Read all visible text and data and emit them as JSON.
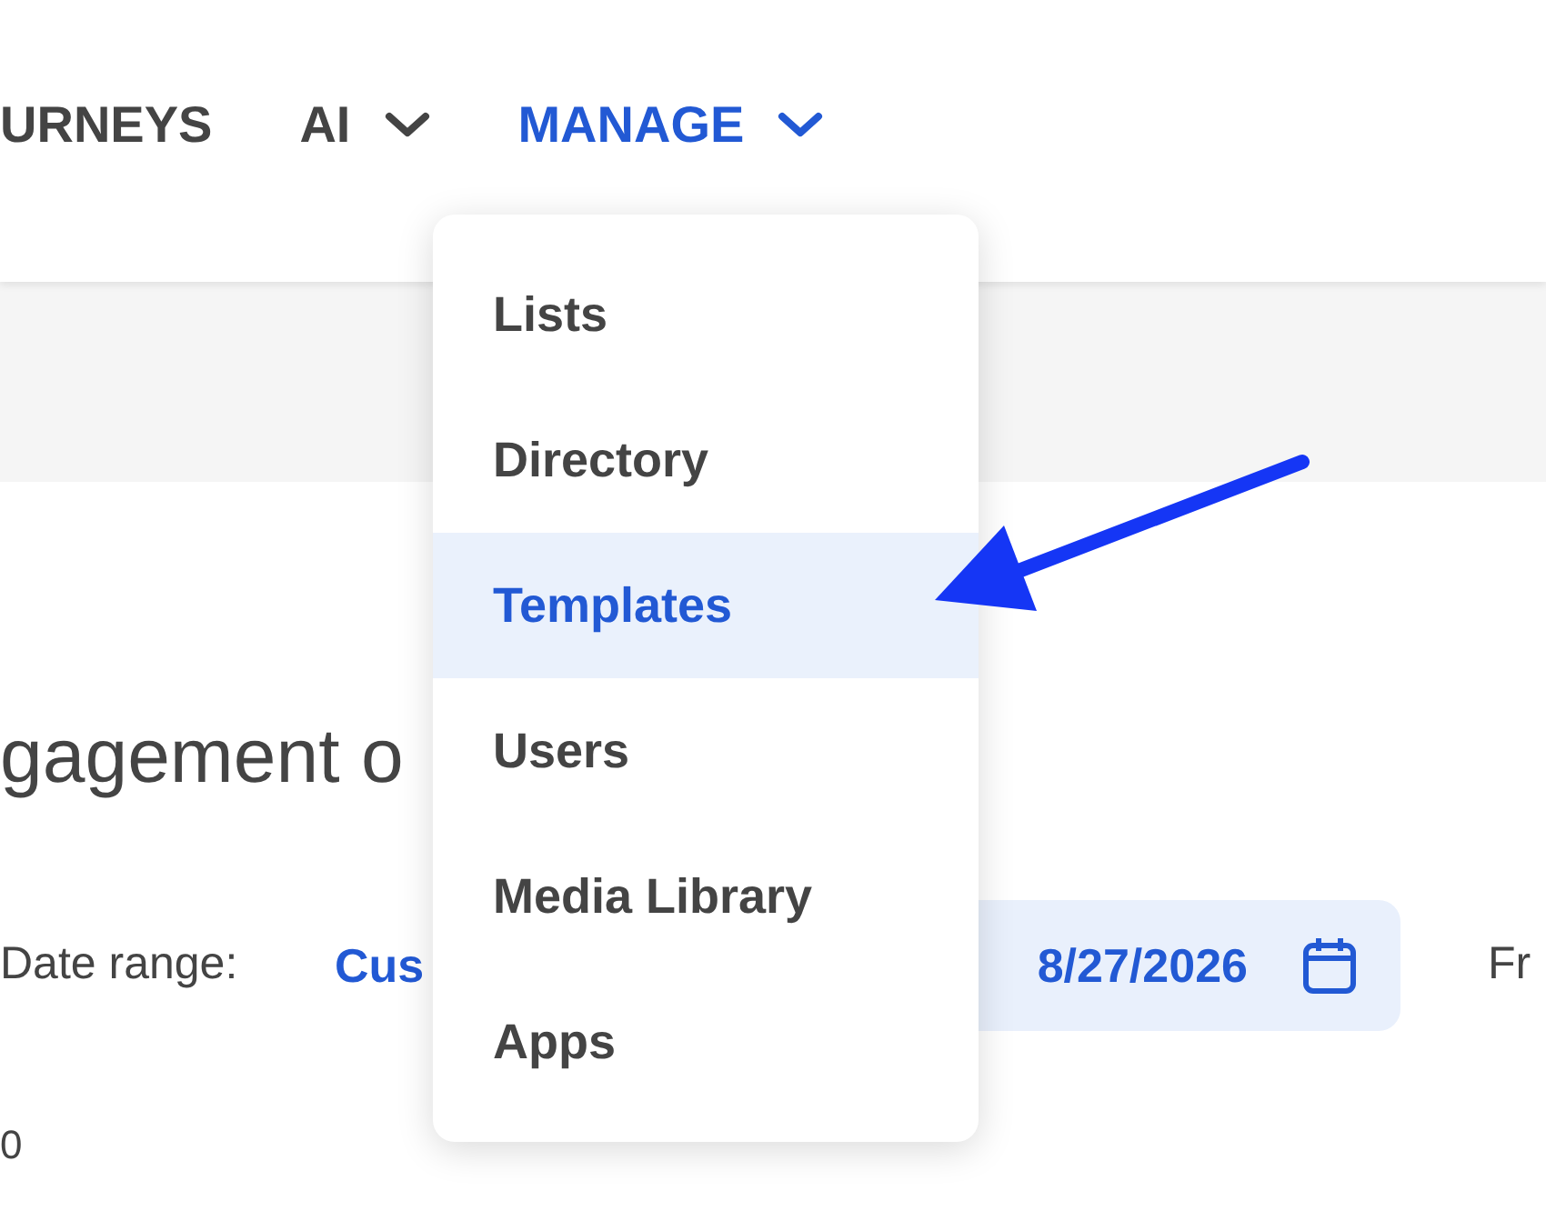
{
  "nav": [
    {
      "label": "URNEYS",
      "has_dropdown": false,
      "selected": false
    },
    {
      "label": "AI",
      "has_dropdown": true,
      "selected": false
    },
    {
      "label": "MANAGE",
      "has_dropdown": true,
      "selected": true
    }
  ],
  "manage_menu": [
    {
      "label": "Lists",
      "selected": false
    },
    {
      "label": "Directory",
      "selected": false
    },
    {
      "label": "Templates",
      "selected": true
    },
    {
      "label": "Users",
      "selected": false
    },
    {
      "label": "Media Library",
      "selected": false
    },
    {
      "label": "Apps",
      "selected": false
    }
  ],
  "page_title": "gagement o",
  "filters": {
    "date_range_label": "Date range:",
    "date_range_value": "Cus",
    "date_end": "8/27/2026",
    "next_label": "Fr"
  },
  "chart_axis_label": "0"
}
